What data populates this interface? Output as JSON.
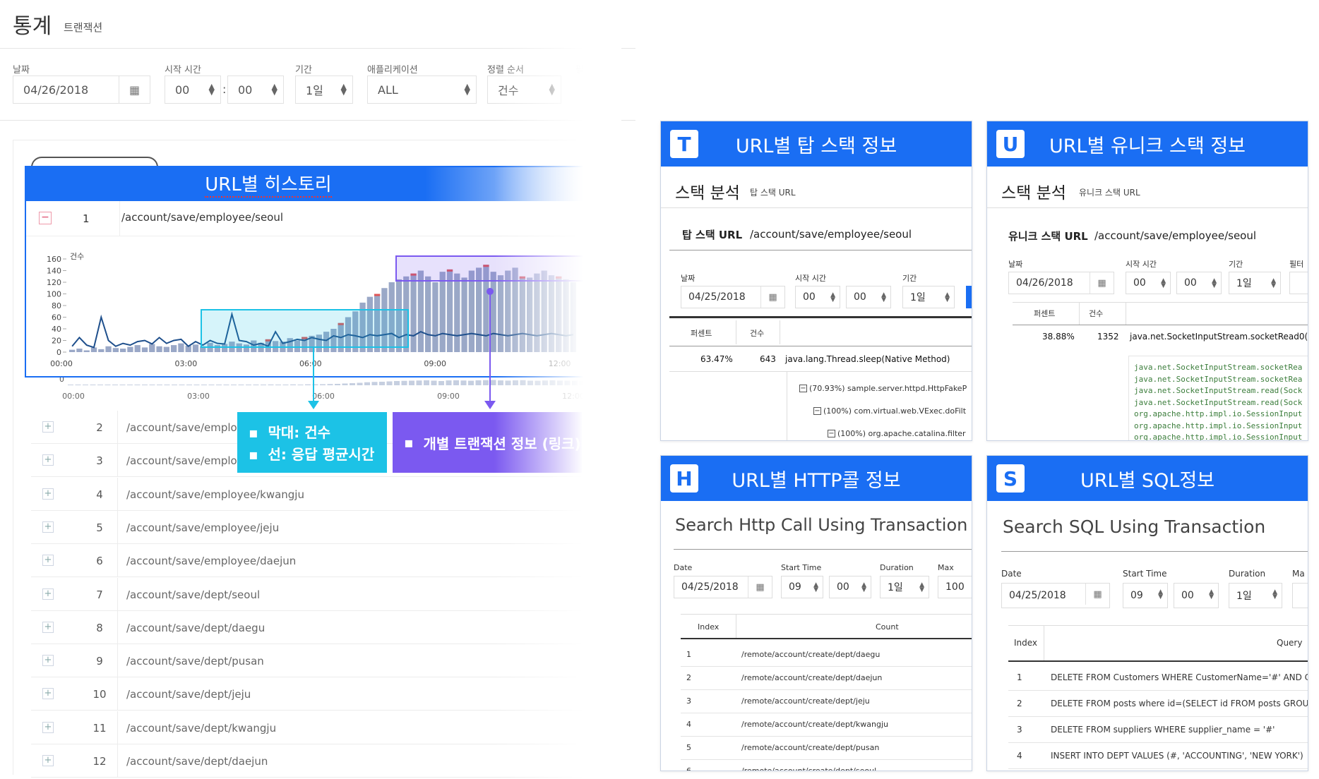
{
  "header": {
    "title": "통계",
    "subtitle": "트랜잭션"
  },
  "filters": {
    "date_label": "날짜",
    "date_value": "04/26/2018",
    "start_label": "시작 시간",
    "start_hour": "00",
    "start_min": "00",
    "start_sep": ":",
    "duration_label": "기간",
    "duration_value": "1일",
    "app_label": "애플리케이션",
    "app_value": "ALL",
    "sort_label": "정렬 순서",
    "sort_value": "건수",
    "extra_label": "필터"
  },
  "histogram": {
    "title": "URL별 히스토리",
    "first_row": {
      "index": "1",
      "url": "/account/save/employee/seoul",
      "minus": "−"
    },
    "y_ticks": [
      "160",
      "140",
      "120",
      "100",
      "80",
      "60",
      "40",
      "20",
      "0"
    ],
    "y_unit": "건수",
    "x_ticks": [
      "00:00",
      "03:00",
      "06:00",
      "09:00",
      "12:00"
    ],
    "mini_x_ticks": [
      "00:00",
      "03:00",
      "06:00",
      "09:00",
      "12:00"
    ],
    "mini_zero": "0"
  },
  "chart_data": {
    "type": "bar",
    "x": [
      "00:00",
      "03:00",
      "06:00",
      "09:00",
      "12:00"
    ],
    "ylim": [
      0,
      160
    ],
    "series": [
      {
        "values": [
          4,
          6,
          3,
          8,
          5,
          10,
          7,
          6,
          9,
          12,
          8,
          14,
          10,
          9,
          12,
          15,
          11,
          13,
          10,
          16,
          12,
          14,
          18,
          15,
          13,
          20,
          16,
          22,
          19,
          18,
          24,
          20,
          26,
          28,
          30,
          35,
          40,
          50,
          60,
          70,
          85,
          95,
          100,
          110,
          120,
          125,
          130,
          135,
          140,
          130,
          120,
          138,
          142,
          135,
          128,
          140,
          145,
          150,
          138,
          132,
          140,
          145,
          130,
          128,
          135,
          140,
          132,
          130,
          125,
          120
        ]
      },
      {
        "values": [
          10,
          25,
          12,
          8,
          60,
          20,
          10,
          15,
          12,
          18,
          20,
          14,
          25,
          15,
          20,
          22,
          10,
          18,
          12,
          20,
          15,
          14,
          65,
          20,
          18,
          12,
          15,
          10,
          35,
          15,
          18,
          22,
          20,
          25,
          22,
          20,
          28,
          25,
          30,
          28,
          25,
          30,
          28,
          30,
          32,
          25,
          30,
          28,
          35,
          30,
          28,
          32,
          30,
          28,
          30,
          32,
          30,
          28,
          32,
          30,
          28,
          30,
          32,
          30,
          28,
          30,
          32,
          30,
          28,
          30
        ]
      }
    ]
  },
  "callouts": {
    "left_line1": "막대: 건수",
    "left_line2": "선: 응답 평균시간",
    "right": "개별 트랜잭션 정보 (링크)",
    "bullet": "▪"
  },
  "url_rows": [
    {
      "index": "2",
      "url": "/account/save/employee/incheon",
      "shown": "/account/save/employ"
    },
    {
      "index": "3",
      "url": "/account/save/employee/busan",
      "shown": "/account/save/employ"
    },
    {
      "index": "4",
      "url": "/account/save/employee/kwangju",
      "shown": "/account/save/employee/kwangju"
    },
    {
      "index": "5",
      "url": "/account/save/employee/jeju",
      "shown": "/account/save/employee/jeju"
    },
    {
      "index": "6",
      "url": "/account/save/employee/daejun",
      "shown": "/account/save/employee/daejun"
    },
    {
      "index": "7",
      "url": "/account/save/dept/seoul",
      "shown": "/account/save/dept/seoul"
    },
    {
      "index": "8",
      "url": "/account/save/dept/daegu",
      "shown": "/account/save/dept/daegu"
    },
    {
      "index": "9",
      "url": "/account/save/dept/pusan",
      "shown": "/account/save/dept/pusan"
    },
    {
      "index": "10",
      "url": "/account/save/dept/jeju",
      "shown": "/account/save/dept/jeju"
    },
    {
      "index": "11",
      "url": "/account/save/dept/kwangju",
      "shown": "/account/save/dept/kwangju"
    },
    {
      "index": "12",
      "url": "/account/save/dept/daejun",
      "shown": "/account/save/dept/daejun"
    }
  ],
  "plus": "+",
  "card_t": {
    "letter": "T",
    "title": "URL별 탑 스택 정보",
    "section": "스택 분석",
    "section_sub": "탑 스택 URL",
    "url_label": "탑 스택 URL",
    "url": "/account/save/employee/seoul",
    "date_label": "날짜",
    "date": "04/25/2018",
    "start_label": "시작 시간",
    "h": "00",
    "m": "00",
    "dur_label": "기간",
    "dur": "1일",
    "col_pct": "퍼센트",
    "col_cnt": "건수",
    "pct": "63.47%",
    "cnt": "643",
    "method": "java.lang.Thread.sleep(Native Method)",
    "tree": [
      "(70.93%) sample.server.httpd.HttpFakeP",
      "(100%) com.virtual.web.VExec.doFilt",
      "(100%) org.apache.catalina.filter"
    ]
  },
  "card_u": {
    "letter": "U",
    "title": "URL별 유니크 스택 정보",
    "section": "스택 분석",
    "section_sub": "유니크 스택 URL",
    "url_label": "유니크 스택 URL",
    "url": "/account/save/employee/seoul",
    "date_label": "날짜",
    "date": "04/26/2018",
    "start_label": "시작 시간",
    "h": "00",
    "m": "00",
    "dur_label": "기간",
    "dur": "1일",
    "filter_label": "필터",
    "col_pct": "퍼센트",
    "col_cnt": "건수",
    "pct": "38.88%",
    "cnt": "1352",
    "method": "java.net.SocketInputStream.socketRead0(Nat",
    "stack": [
      "java.net.SocketInputStream.socketRea",
      "java.net.SocketInputStream.socketRea",
      "java.net.SocketInputStream.read(Sock",
      "java.net.SocketInputStream.read(Sock",
      "org.apache.http.impl.io.SessionInput",
      "org.apache.http.impl.io.SessionInput",
      "org.apache.http.impl.io.SessionInput"
    ]
  },
  "card_h": {
    "letter": "H",
    "title": "URL별 HTTP콜 정보",
    "section": "Search Http Call Using Transaction",
    "date_label": "Date",
    "date": "04/25/2018",
    "start_label": "Start Time",
    "h": "09",
    "m": "00",
    "dur_label": "Duration",
    "dur": "1일",
    "max_label": "Max",
    "max": "100",
    "col_index": "Index",
    "col_count": "Count",
    "rows": [
      {
        "i": "1",
        "u": "/remote/account/create/dept/daegu"
      },
      {
        "i": "2",
        "u": "/remote/account/create/dept/daejun"
      },
      {
        "i": "3",
        "u": "/remote/account/create/dept/jeju"
      },
      {
        "i": "4",
        "u": "/remote/account/create/dept/kwangju"
      },
      {
        "i": "5",
        "u": "/remote/account/create/dept/pusan"
      },
      {
        "i": "6",
        "u": "/remote/account/create/dept/seoul"
      }
    ]
  },
  "card_s": {
    "letter": "S",
    "title": "URL별 SQL정보",
    "section": "Search SQL Using Transaction",
    "date_label": "Date",
    "date": "04/25/2018",
    "start_label": "Start Time",
    "h": "09",
    "m": "00",
    "dur_label": "Duration",
    "dur": "1일",
    "max_label": "Ma",
    "col_index": "Index",
    "col_query": "Query",
    "rows": [
      {
        "i": "1",
        "q": "DELETE FROM Customers WHERE CustomerName='#' AND Co"
      },
      {
        "i": "2",
        "q": "DELETE FROM posts where id=(SELECT id FROM posts GROUP"
      },
      {
        "i": "3",
        "q": "DELETE FROM suppliers WHERE supplier_name = '#'"
      },
      {
        "i": "4",
        "q": "INSERT INTO DEPT VALUES (#, 'ACCOUNTING', 'NEW YORK')"
      }
    ]
  },
  "icons": {
    "calendar": "calendar-icon",
    "spinner": "spinner-icon",
    "expand": "plus-icon",
    "collapse": "minus-icon"
  },
  "colors": {
    "accent": "#1a6ef3",
    "cyan": "#1cc2e6",
    "purple": "#7b59f0",
    "bar": "#9aa8c7",
    "line": "#1e4f8c"
  }
}
